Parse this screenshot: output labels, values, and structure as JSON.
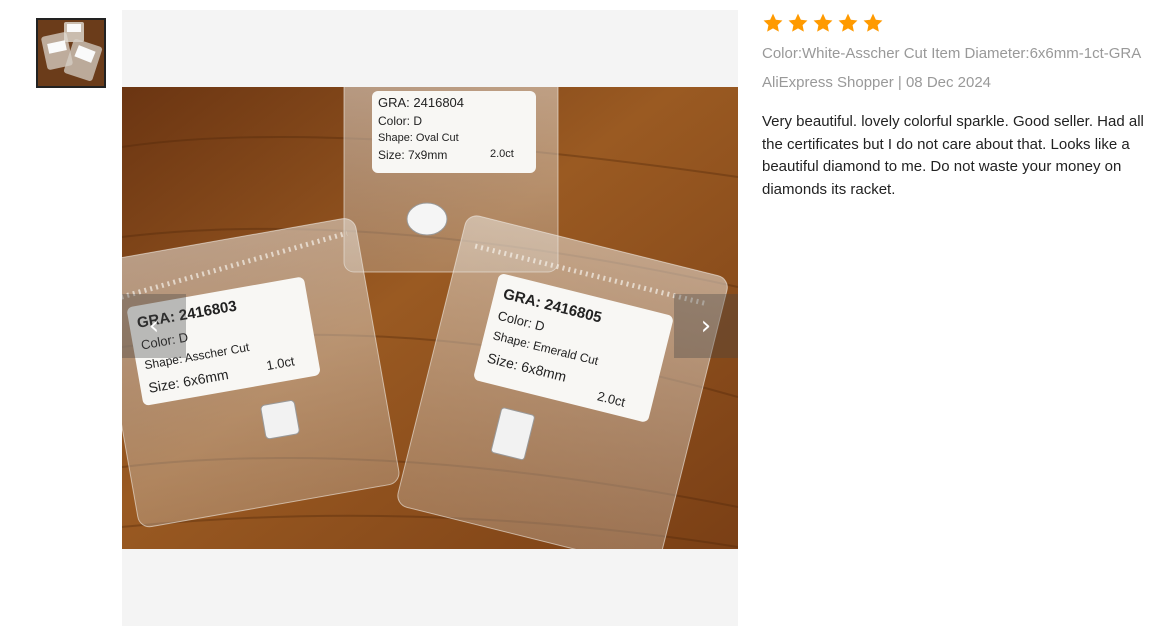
{
  "thumbnails": [
    {
      "alt": "review photo 1",
      "selected": true
    }
  ],
  "viewer": {
    "prev_glyph": "‹",
    "next_glyph": "›",
    "cards": [
      {
        "line1": "GRA: 2416804",
        "line2": "Color: D",
        "line3": "Shape: Oval Cut",
        "line4": "Size: 7x9mm",
        "weight": "2.0ct"
      },
      {
        "line1": "GRA: 2416803",
        "line2": "Color: D",
        "line3": "Shape: Asscher Cut",
        "line4": "Size: 6x6mm",
        "weight": "1.0ct"
      },
      {
        "line1": "GRA: 2416805",
        "line2": "Color: D",
        "line3": "Shape: Emerald Cut",
        "line4": "Size: 6x8mm",
        "weight": "2.0ct"
      }
    ]
  },
  "review": {
    "rating": 5,
    "max_rating": 5,
    "star_color": "#ff9a00",
    "sku": "Color:White-Asscher Cut Item Diameter:6x6mm-1ct-GRA",
    "author_date": "AliExpress Shopper | 08 Dec 2024",
    "text": "Very beautiful. lovely colorful sparkle. Good seller. Had all the certificates but I do not care about that. Looks like a beautiful diamond to me. Do not waste your money on diamonds its racket."
  }
}
